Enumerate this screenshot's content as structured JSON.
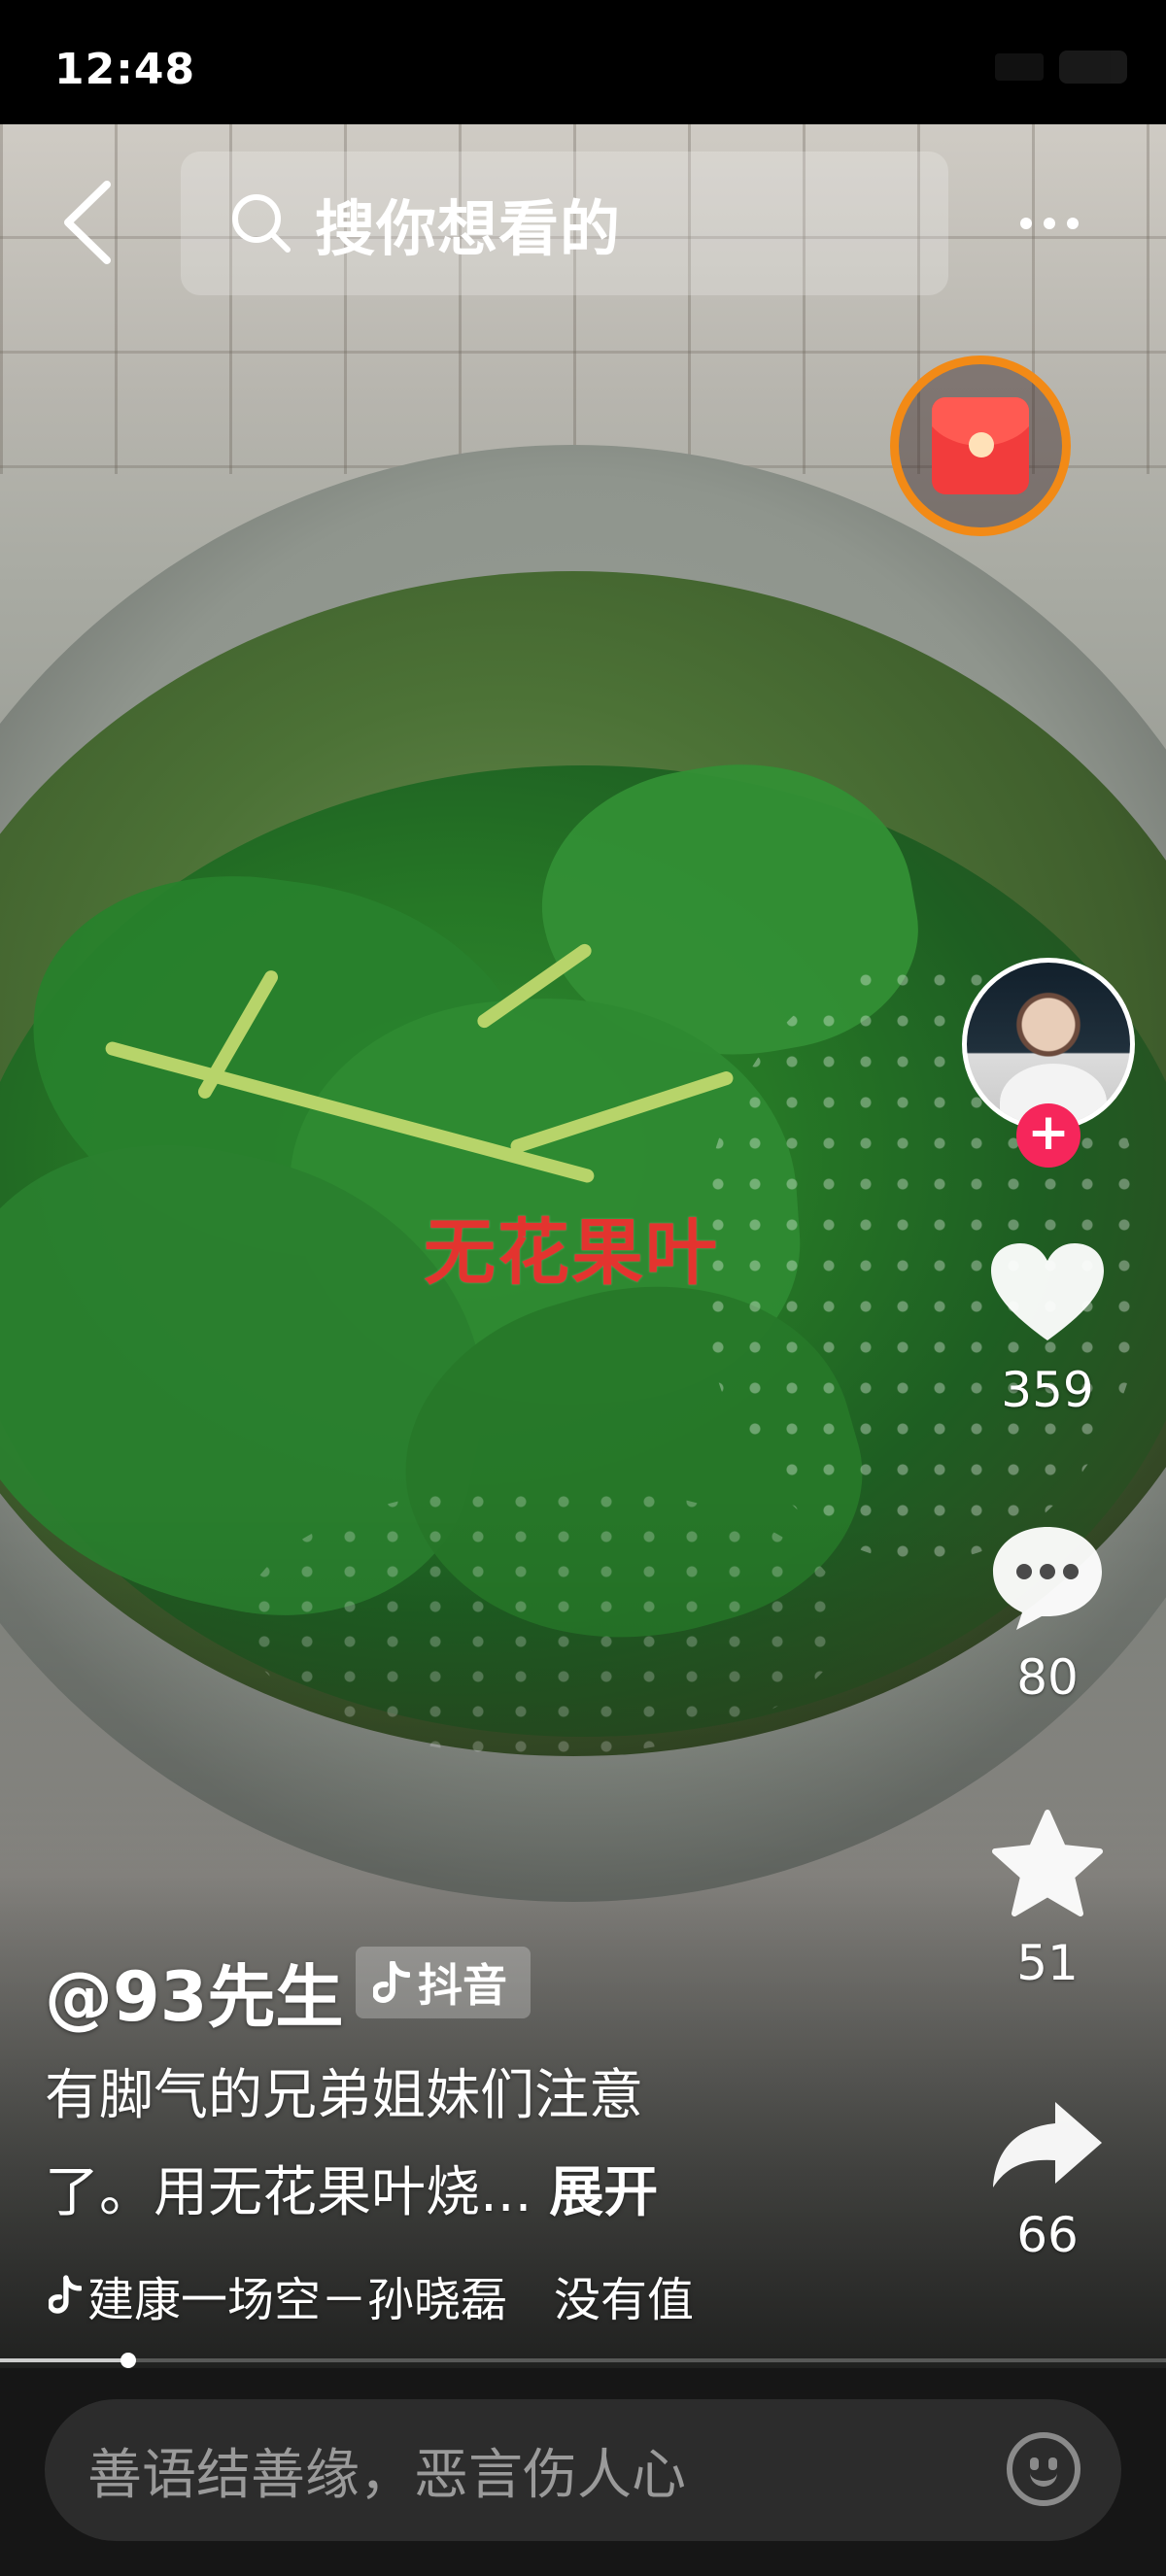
{
  "status_bar": {
    "time": "12:48"
  },
  "search": {
    "placeholder": "搜你想看的"
  },
  "video": {
    "caption": "无花果叶"
  },
  "rail": {
    "like_count": "359",
    "comment_count": "80",
    "favorite_count": "51",
    "share_count": "66"
  },
  "post": {
    "author": "@93先生",
    "platform_badge": "抖音",
    "description_line1": "有脚气的兄弟姐妹们注意",
    "description_line2": "了。用无花果叶烧...",
    "expand_label": "展开",
    "music": "建康一场空－孙晓磊　没有值"
  },
  "playback": {
    "progress_fraction": 0.11
  },
  "comment": {
    "placeholder": "善语结善缘，恶言伤人心"
  },
  "colors": {
    "follow": "#f6265b",
    "red_packet_ring": "#f28a16",
    "caption": "#e3342f"
  },
  "icons": [
    "back-icon",
    "search-icon",
    "more-icon",
    "red-packet-icon",
    "plus-icon",
    "heart-icon",
    "comment-icon",
    "star-icon",
    "share-icon",
    "douyin-icon",
    "music-note-icon",
    "emoji-icon"
  ]
}
